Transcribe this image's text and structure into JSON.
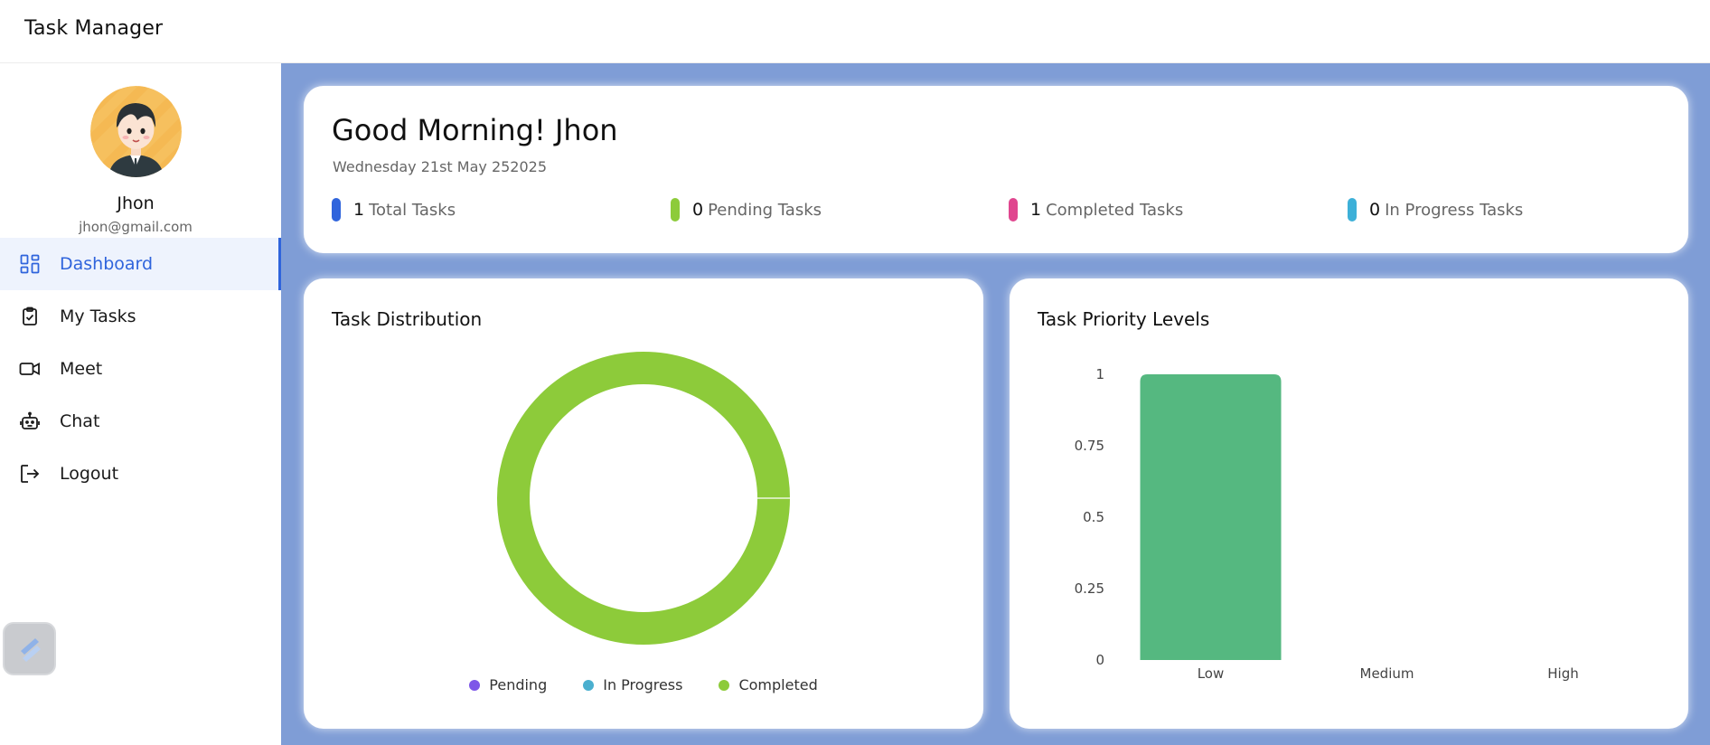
{
  "app": {
    "title": "Task Manager"
  },
  "user": {
    "name": "Jhon",
    "email": "jhon@gmail.com"
  },
  "nav": {
    "items": [
      {
        "label": "Dashboard",
        "icon": "dashboard-grid-icon",
        "active": true
      },
      {
        "label": "My Tasks",
        "icon": "clipboard-check-icon",
        "active": false
      },
      {
        "label": "Meet",
        "icon": "video-camera-icon",
        "active": false
      },
      {
        "label": "Chat",
        "icon": "robot-icon",
        "active": false
      },
      {
        "label": "Logout",
        "icon": "logout-icon",
        "active": false
      }
    ]
  },
  "greeting": {
    "text": "Good Morning! Jhon",
    "date": "Wednesday 21st May 252025"
  },
  "stats": [
    {
      "value": "1",
      "label": "Total Tasks",
      "color": "#2f64dc"
    },
    {
      "value": "0",
      "label": "Pending Tasks",
      "color": "#8dcb3a"
    },
    {
      "value": "1",
      "label": "Completed Tasks",
      "color": "#e0468f"
    },
    {
      "value": "0",
      "label": "In Progress Tasks",
      "color": "#3db0d8"
    }
  ],
  "distribution": {
    "title": "Task Distribution",
    "legend": [
      {
        "label": "Pending",
        "color": "#7e57e8"
      },
      {
        "label": "In Progress",
        "color": "#4aafcf"
      },
      {
        "label": "Completed",
        "color": "#8dcb3a"
      }
    ]
  },
  "priority": {
    "title": "Task Priority Levels"
  },
  "chart_data": [
    {
      "type": "pie",
      "title": "Task Distribution",
      "categories": [
        "Pending",
        "In Progress",
        "Completed"
      ],
      "values": [
        0,
        0,
        1
      ],
      "colors": [
        "#7e57e8",
        "#4aafcf",
        "#8dcb3a"
      ],
      "donut": true,
      "legend": "bottom"
    },
    {
      "type": "bar",
      "title": "Task Priority Levels",
      "categories": [
        "Low",
        "Medium",
        "High"
      ],
      "values": [
        1,
        0,
        0
      ],
      "ylim": [
        0,
        1
      ],
      "yticks": [
        "0",
        "0.25",
        "0.5",
        "0.75",
        "1"
      ],
      "bar_color": "#55b880",
      "grid": false
    }
  ],
  "colors": {
    "accent": "#2f64dc",
    "main_bg": "#7f9dd6",
    "active_bg": "#eef3fd"
  }
}
